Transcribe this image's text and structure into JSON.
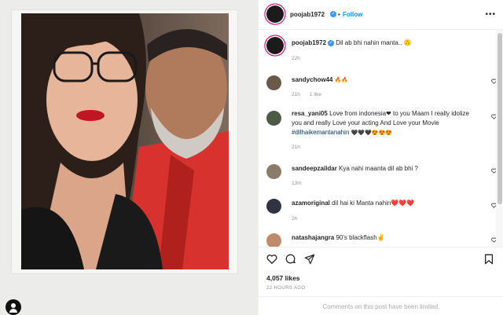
{
  "post": {
    "author": "poojab1972",
    "follow_label": "Follow",
    "more_label": "•••",
    "caption": "Dil ab bhi nahin manta.. 🙃",
    "caption_time": "22h"
  },
  "comments": [
    {
      "user": "sandychow44",
      "text": "🔥🔥",
      "time": "21h",
      "likes": "1 like",
      "avatar": "#6a5a4c"
    },
    {
      "user": "resa_yani05",
      "text_line1": "Love from indonesia❤ to you Maam I really idolize",
      "text_line2": "you and really Love your acting And Love your Movie",
      "hashtag": "#dilhaikemantanahin",
      "text_tail": "🖤🖤🖤😍😍😍",
      "time": "21h",
      "avatar": "#4d5a48"
    },
    {
      "user": "sandeepzaildar",
      "text": "Kya nahi maanta dil ab bhi ?",
      "time": "13m",
      "avatar": "#8b7b6b"
    },
    {
      "user": "azamoriginal",
      "text": "dil hai ki Manta nahin❤️❤️❤️",
      "time": "2h",
      "avatar": "#2f3440"
    },
    {
      "user": "natashajangra",
      "text": "90's blackflash✌️",
      "avatar": "#c08b6a"
    }
  ],
  "actions": {
    "icons": [
      "heart-icon",
      "comment-icon",
      "share-icon",
      "bookmark-icon"
    ],
    "likes": "4,057 likes",
    "posted": "22 HOURS AGO",
    "limited": "Comments on this post have been limited."
  },
  "colors": {
    "accent": "#0095f6",
    "verified": "#3897f0",
    "ring": "#d3006c"
  }
}
